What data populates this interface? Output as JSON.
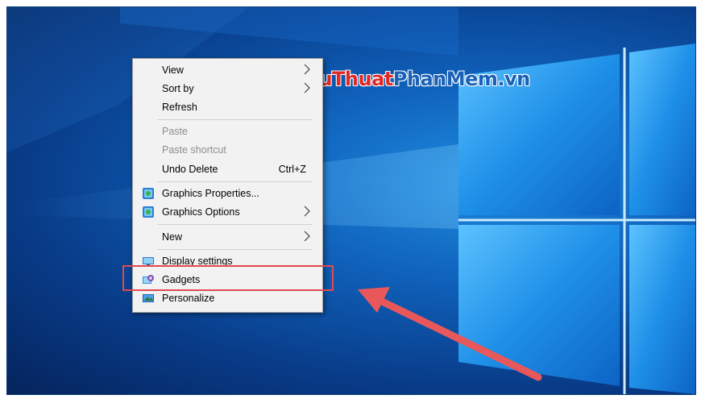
{
  "watermark": {
    "part1": "ThuThuat",
    "part2": "PhanMem",
    "part3": ".vn"
  },
  "context_menu": {
    "items": [
      {
        "label": "View",
        "submenu": true
      },
      {
        "label": "Sort by",
        "submenu": true
      },
      {
        "label": "Refresh"
      },
      {
        "label": "Paste",
        "disabled": true
      },
      {
        "label": "Paste shortcut",
        "disabled": true
      },
      {
        "label": "Undo Delete",
        "shortcut": "Ctrl+Z"
      },
      {
        "label": "Graphics Properties...",
        "icon": "intel-graphics-icon"
      },
      {
        "label": "Graphics Options",
        "icon": "intel-graphics-icon",
        "submenu": true
      },
      {
        "label": "New",
        "submenu": true
      },
      {
        "label": "Display settings",
        "icon": "display-icon"
      },
      {
        "label": "Gadgets",
        "icon": "gadgets-icon",
        "highlighted": true
      },
      {
        "label": "Personalize",
        "icon": "personalize-icon"
      }
    ]
  },
  "colors": {
    "highlight_box": "#e04a52",
    "arrow": "#e8585a",
    "desktop_blue": "#0f5fb8"
  }
}
